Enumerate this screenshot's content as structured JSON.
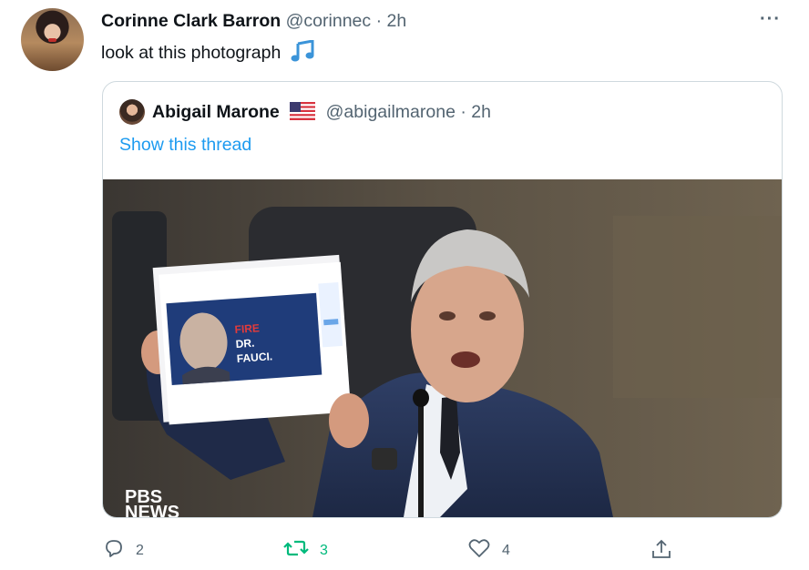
{
  "tweet": {
    "author_name": "Corinne Clark Barron",
    "handle": "@corinnec",
    "separator": "·",
    "time": "2h",
    "text": "look at this photograph",
    "emoji_icon": "musical-notes-icon",
    "more_icon": "more-options-icon"
  },
  "quote": {
    "author_name": "Abigail Marone",
    "flag_icon": "us-flag-icon",
    "handle": "@abigailmarone",
    "separator": "·",
    "time": "2h",
    "show_thread": "Show this thread",
    "image": {
      "sign_text": [
        "FIRE",
        "DR.",
        "FAUCI."
      ],
      "watermark": [
        "PBS",
        "NEWS"
      ]
    }
  },
  "actions": {
    "reply_count": "2",
    "retweet_count": "3",
    "like_count": "4"
  },
  "colors": {
    "link": "#1d9bf0",
    "retweet": "#00ba7c",
    "secondary": "#536471",
    "border": "#cfd9de"
  }
}
